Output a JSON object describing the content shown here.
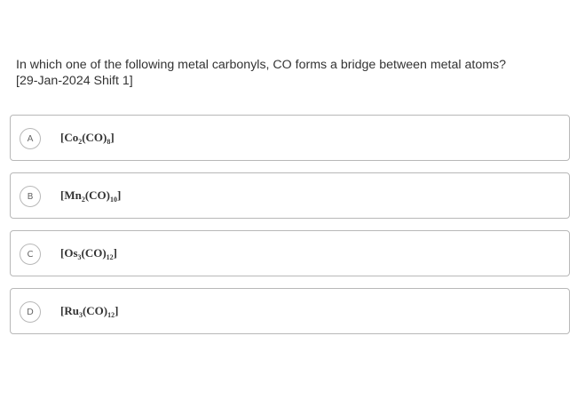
{
  "question": {
    "line1": "In which one of the following metal carbonyls, CO forms a bridge between metal atoms?",
    "line2": "[29-Jan-2024 Shift 1]"
  },
  "options": [
    {
      "letter": "A",
      "formula": [
        {
          "t": "[Co",
          "sub": false
        },
        {
          "t": "2",
          "sub": true
        },
        {
          "t": "(CO)",
          "sub": false
        },
        {
          "t": "8",
          "sub": true
        },
        {
          "t": "]",
          "sub": false
        }
      ]
    },
    {
      "letter": "B",
      "formula": [
        {
          "t": "[Mn",
          "sub": false
        },
        {
          "t": "2",
          "sub": true
        },
        {
          "t": "(CO)",
          "sub": false
        },
        {
          "t": "10",
          "sub": true
        },
        {
          "t": "]",
          "sub": false
        }
      ]
    },
    {
      "letter": "C",
      "formula": [
        {
          "t": "[Os",
          "sub": false
        },
        {
          "t": "3",
          "sub": true
        },
        {
          "t": "(CO)",
          "sub": false
        },
        {
          "t": "12",
          "sub": true
        },
        {
          "t": "]",
          "sub": false
        }
      ]
    },
    {
      "letter": "D",
      "formula": [
        {
          "t": "[Ru",
          "sub": false
        },
        {
          "t": "3",
          "sub": true
        },
        {
          "t": "(CO)",
          "sub": false
        },
        {
          "t": "12",
          "sub": true
        },
        {
          "t": "]",
          "sub": false
        }
      ]
    }
  ]
}
